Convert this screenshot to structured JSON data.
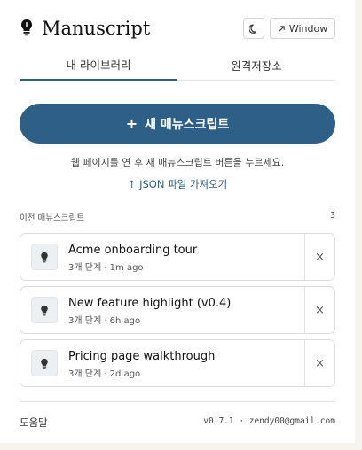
{
  "header": {
    "title": "Manuscript",
    "logo_icon": "bulb-icon",
    "theme_icon": "moon-icon",
    "window_icon": "arrow-up-right-icon",
    "window_label": "Window"
  },
  "tabs": [
    {
      "label": "내 라이브러리",
      "active": true
    },
    {
      "label": "원격저장소",
      "active": false
    }
  ],
  "actions": {
    "new_plus": "+",
    "new_label": "새 매뉴스크립트",
    "hint": "웹 페이지를 연 후 새 매뉴스크립트 버튼을 누르세요.",
    "import_label": "↑ JSON 파일 가져오기"
  },
  "section": {
    "title": "이전 매뉴스크립트",
    "count": "3"
  },
  "manuscripts": [
    {
      "title": "Acme onboarding tour",
      "meta": "3개 단계 · 1m ago",
      "delete": "×"
    },
    {
      "title": "New feature highlight (v0.4)",
      "meta": "3개 단계 · 6h ago",
      "delete": "×"
    },
    {
      "title": "Pricing page walkthrough",
      "meta": "3개 단계 · 2d ago",
      "delete": "×"
    }
  ],
  "footer": {
    "help": "도움말",
    "version": "v0.7.1 · zendy00@gmail.com"
  },
  "colors": {
    "accent": "#2e5f86",
    "background": "#f6f4ec",
    "panel": "#ffffff"
  }
}
